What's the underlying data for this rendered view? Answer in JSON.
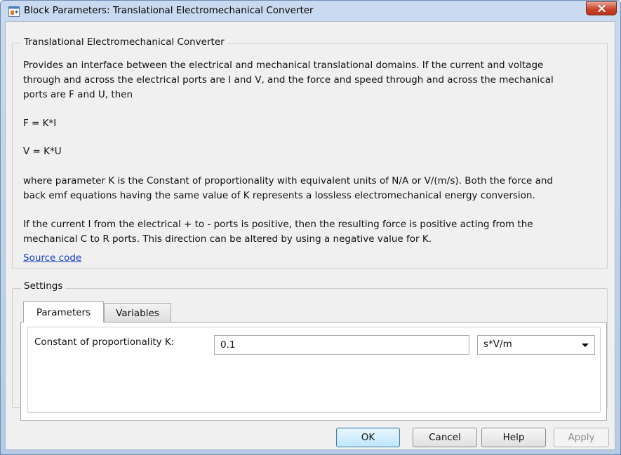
{
  "window": {
    "title": "Block Parameters: Translational Electromechanical Converter",
    "close_symbol": "✕",
    "icon": "simulink-block-icon"
  },
  "description": {
    "group_label": "Translational Electromechanical Converter",
    "lines": [
      "Provides an interface between the electrical and mechanical translational domains. If the current and voltage",
      "through and across the electrical ports are I and V, and the force and speed through and across the mechanical",
      "ports are F and U, then",
      "F = K*I",
      "V = K*U",
      "where parameter K is the Constant of proportionality with equivalent units of N/A or V/(m/s). Both the force and",
      "back emf equations having the same value of K represents a lossless electromechanical energy conversion.",
      "If the current I from the electrical + to - ports is positive, then the resulting force is positive acting from the",
      "mechanical C to R ports. This direction can be altered by using a negative value for K."
    ],
    "source_link": "Source code"
  },
  "settings": {
    "group_label": "Settings",
    "tabs": [
      {
        "label": "Parameters",
        "active": true
      },
      {
        "label": "Variables",
        "active": false
      }
    ],
    "fields": [
      {
        "label": "Constant of proportionality K:",
        "value": "0.1",
        "unit": "s*V/m"
      }
    ]
  },
  "buttons": {
    "ok": "OK",
    "cancel": "Cancel",
    "help": "Help",
    "apply": "Apply"
  }
}
